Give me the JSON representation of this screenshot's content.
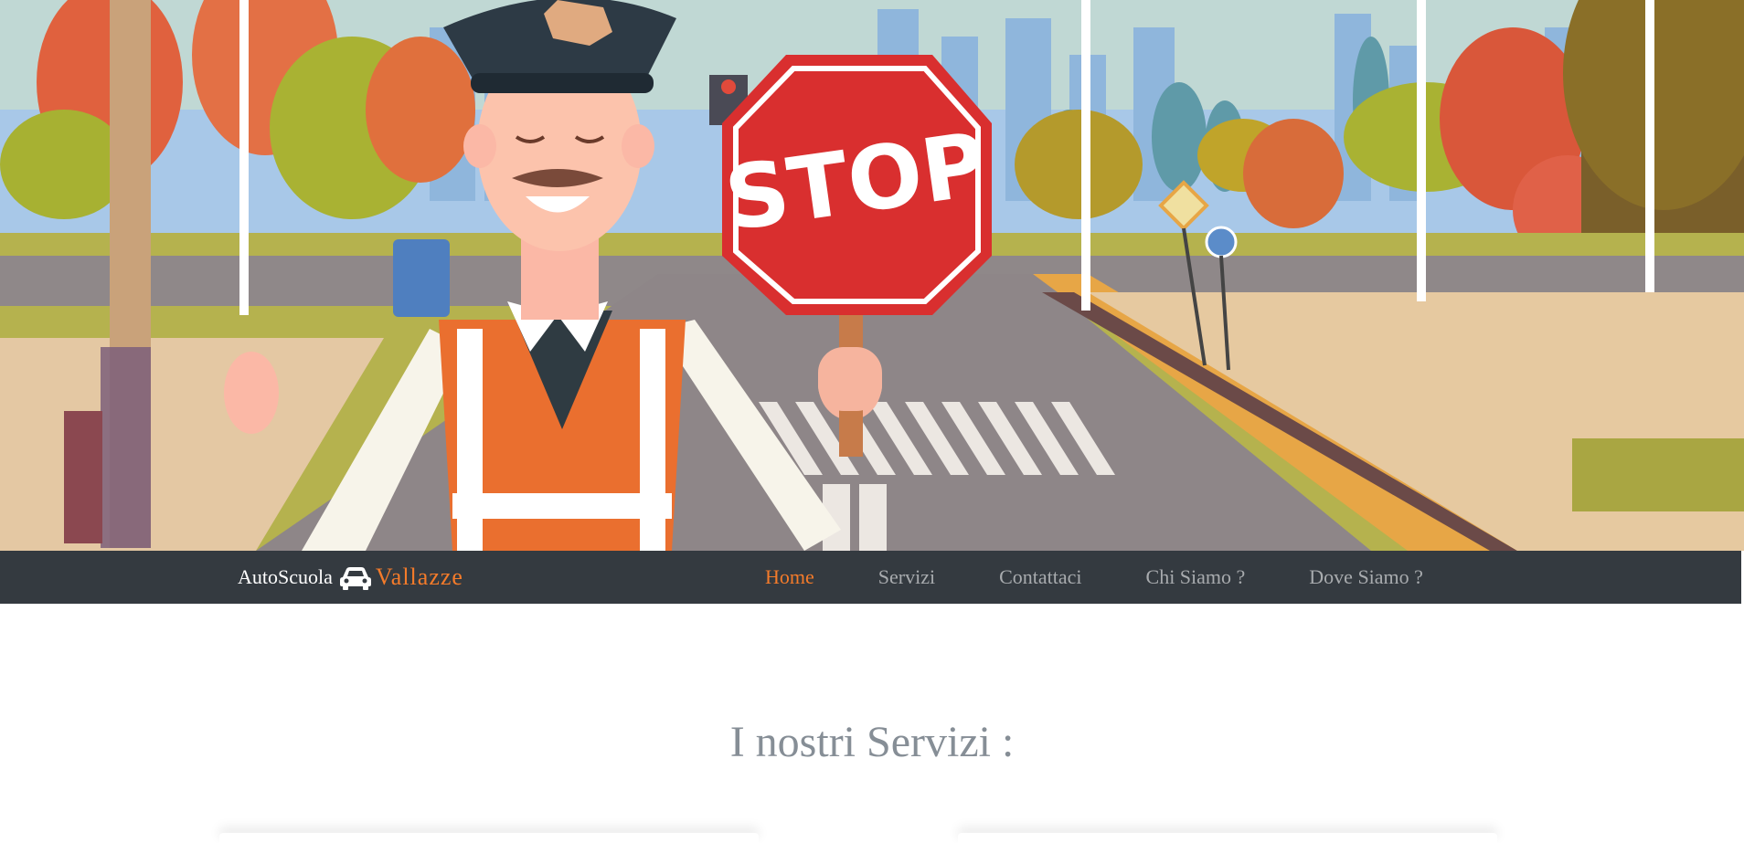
{
  "hero": {
    "sign_text": "STOP"
  },
  "navbar": {
    "brand_prefix": "AutoScuola",
    "brand_icon": "car-icon",
    "brand_name": "Vallazze",
    "links": [
      {
        "label": "Home",
        "active": true
      },
      {
        "label": "Servizi",
        "active": false
      },
      {
        "label": "Contattaci",
        "active": false
      },
      {
        "label": "Chi Siamo ?",
        "active": false
      },
      {
        "label": "Dove Siamo ?",
        "active": false
      }
    ]
  },
  "main": {
    "section_title": "I nostri Servizi :"
  },
  "colors": {
    "navbar_bg": "#343a40",
    "accent": "#f47b2a",
    "link": "#a8abae",
    "title": "#868e96"
  }
}
